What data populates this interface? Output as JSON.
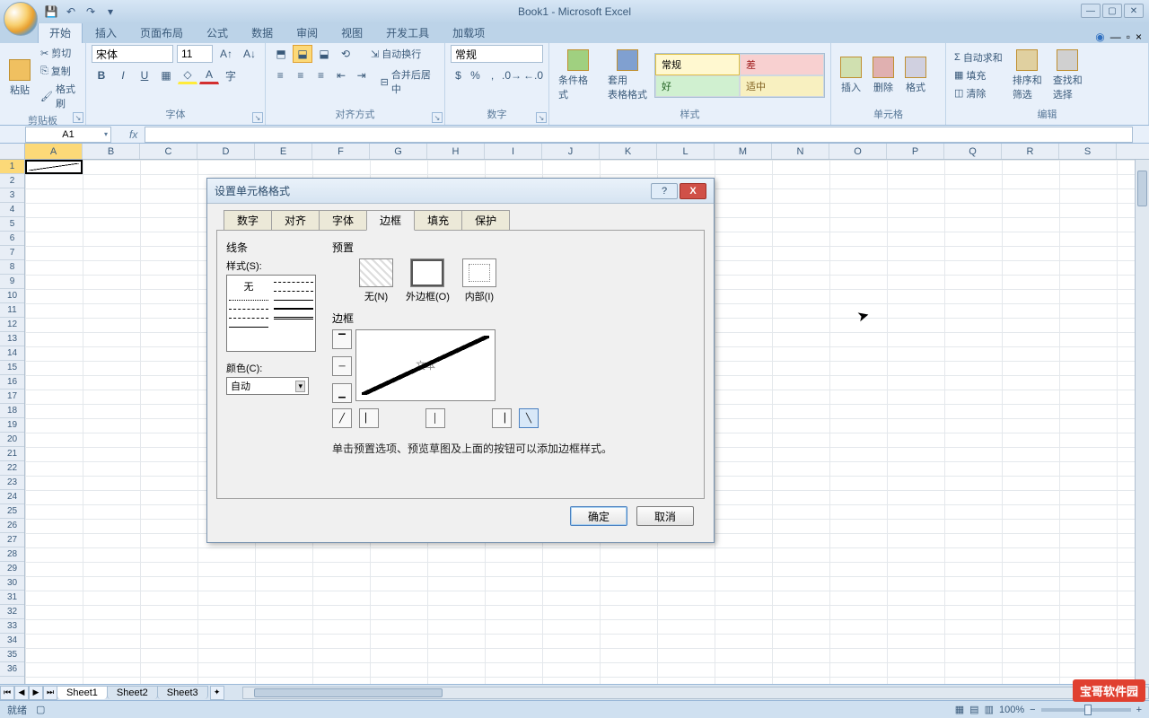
{
  "app": {
    "title": "Book1 - Microsoft Excel"
  },
  "ribbon": {
    "tabs": [
      "开始",
      "插入",
      "页面布局",
      "公式",
      "数据",
      "审阅",
      "视图",
      "开发工具",
      "加载项"
    ],
    "active_tab": 0,
    "clipboard": {
      "label": "剪贴板",
      "paste": "粘贴",
      "cut": "剪切",
      "copy": "复制",
      "format_painter": "格式刷"
    },
    "font": {
      "label": "字体",
      "name": "宋体",
      "size": "11"
    },
    "alignment": {
      "label": "对齐方式",
      "wrap": "自动换行",
      "merge": "合并后居中"
    },
    "number": {
      "label": "数字",
      "format": "常规"
    },
    "styles_group": {
      "label": "样式",
      "cond": "条件格式",
      "table": "套用\n表格格式",
      "gallery": [
        [
          "常规",
          "差"
        ],
        [
          "好",
          "适中"
        ]
      ]
    },
    "cells": {
      "label": "单元格",
      "insert": "插入",
      "delete": "删除",
      "format": "格式"
    },
    "editing": {
      "label": "编辑",
      "autosum": "自动求和",
      "fill": "填充",
      "clear": "清除",
      "sort": "排序和\n筛选",
      "find": "查找和\n选择"
    }
  },
  "formula": {
    "name_box": "A1"
  },
  "columns": [
    "A",
    "B",
    "C",
    "D",
    "E",
    "F",
    "G",
    "H",
    "I",
    "J",
    "K",
    "L",
    "M",
    "N",
    "O",
    "P",
    "Q",
    "R",
    "S"
  ],
  "rows": 36,
  "sheets": [
    "Sheet1",
    "Sheet2",
    "Sheet3"
  ],
  "status": {
    "ready": "就绪",
    "zoom": "100%"
  },
  "dialog": {
    "title": "设置单元格格式",
    "tabs": [
      "数字",
      "对齐",
      "字体",
      "边框",
      "填充",
      "保护"
    ],
    "active_tab": 3,
    "line_label": "线条",
    "style_label": "样式(S):",
    "style_none": "无",
    "color_label": "颜色(C):",
    "color_value": "自动",
    "preset_label": "预置",
    "presets": [
      {
        "label": "无(N)"
      },
      {
        "label": "外边框(O)"
      },
      {
        "label": "内部(I)"
      }
    ],
    "border_label": "边框",
    "preview_text": "文本",
    "hint": "单击预置选项、预览草图及上面的按钮可以添加边框样式。",
    "ok": "确定",
    "cancel": "取消"
  },
  "watermark": "宝哥软件园"
}
